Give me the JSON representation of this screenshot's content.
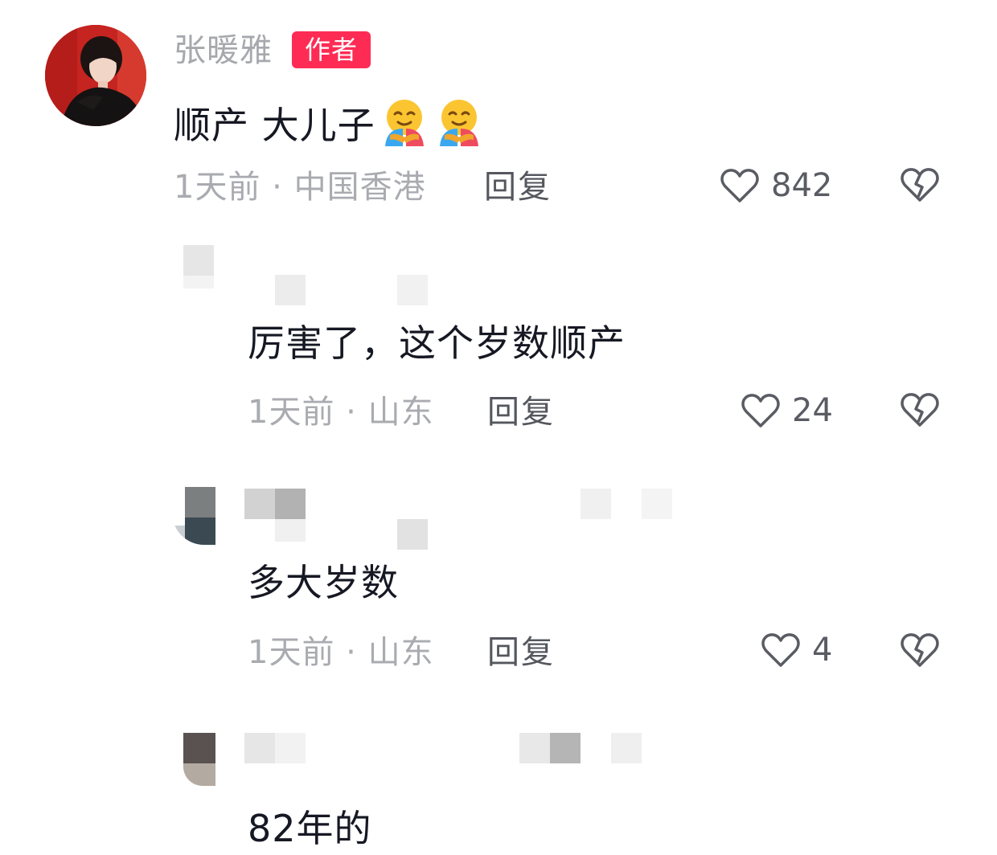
{
  "comments": [
    {
      "username": "张暖雅",
      "badge": "作者",
      "text": "顺产 大儿子",
      "emoji": [
        "hugging-face-emoji",
        "hugging-face-emoji"
      ],
      "time": "1天前",
      "location": "中国香港",
      "meta": "1天前 · 中国香港",
      "reply_label": "回复",
      "likes": "842"
    },
    {
      "text": "厉害了，这个岁数顺产",
      "time": "1天前",
      "location": "山东",
      "meta": "1天前 · 山东",
      "reply_label": "回复",
      "likes": "24"
    },
    {
      "text": "多大岁数",
      "time": "1天前",
      "location": "山东",
      "meta": "1天前 · 山东",
      "reply_label": "回复",
      "likes": "4"
    },
    {
      "text": "82年的"
    }
  ],
  "icons": {
    "like": "heart-outline-icon",
    "dislike": "broken-heart-icon"
  },
  "colors": {
    "badge": "#fe2c55",
    "username": "#a6a8ad",
    "meta": "#a9abb0",
    "text": "#161823"
  }
}
